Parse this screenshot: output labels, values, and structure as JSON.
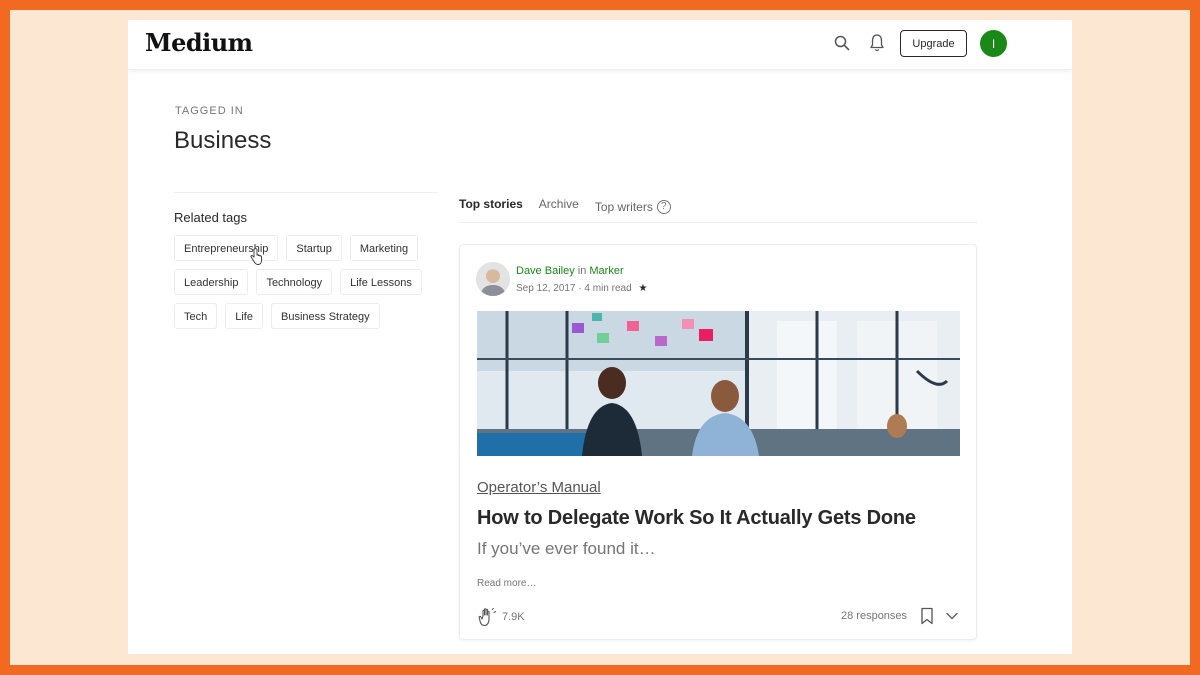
{
  "brand": "Medium",
  "nav": {
    "search_icon": "search-icon",
    "bell_icon": "bell-icon",
    "upgrade_label": "Upgrade",
    "avatar_initial": "I"
  },
  "header": {
    "kicker": "TAGGED IN",
    "title": "Business"
  },
  "sidebar": {
    "heading": "Related tags",
    "tags": [
      [
        "Entrepreneurship",
        "Startup",
        "Marketing"
      ],
      [
        "Leadership",
        "Technology",
        "Life Lessons"
      ],
      [
        "Tech",
        "Life",
        "Business Strategy"
      ]
    ]
  },
  "tabs": [
    {
      "label": "Top stories",
      "active": true
    },
    {
      "label": "Archive",
      "active": false
    },
    {
      "label": "Top writers",
      "active": false,
      "help": "?"
    }
  ],
  "story": {
    "author": "Dave Bailey",
    "in_word": "in",
    "publication": "Marker",
    "date": "Sep 12, 2017",
    "separator": "·",
    "read_time": "4 min read",
    "star": "★",
    "section": "Operator’s Manual",
    "title": "How to Delegate Work So It Actually Gets Done",
    "subtitle": "If you’ve ever found it…",
    "read_more": "Read more…",
    "claps": "7.9K",
    "responses": "28 responses"
  },
  "colors": {
    "frame": "#f26a21",
    "frame_bg": "#fce8d2",
    "accent_green": "#1a8917"
  }
}
